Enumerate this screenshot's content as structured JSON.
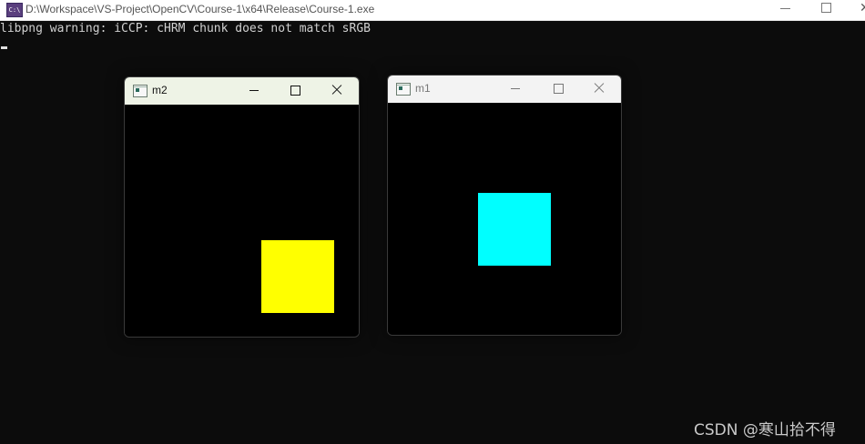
{
  "console": {
    "title": "D:\\Workspace\\VS-Project\\OpenCV\\Course-1\\x64\\Release\\Course-1.exe",
    "icon": "console-app-icon",
    "icon_text": "C:\\",
    "output_line": "libpng warning: iCCP: cHRM chunk does not match sRGB"
  },
  "windows": {
    "m2": {
      "title": "m2",
      "state": "active",
      "square_color": "#ffff00"
    },
    "m1": {
      "title": "m1",
      "state": "inactive",
      "square_color": "#00ffff"
    }
  },
  "watermark": "CSDN @寒山拾不得"
}
